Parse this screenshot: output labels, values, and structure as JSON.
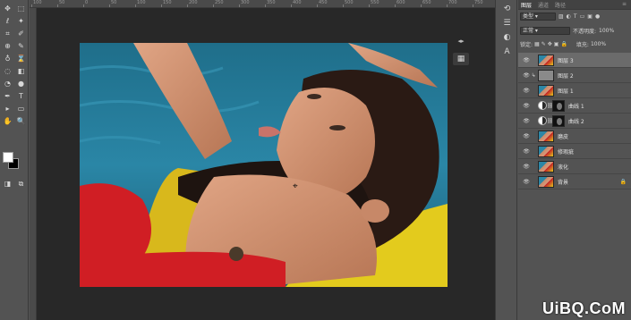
{
  "tools": {
    "rows": [
      [
        "move-icon",
        "marquee-icon"
      ],
      [
        "lasso-icon",
        "magic-wand-icon"
      ],
      [
        "crop-icon",
        "eyedropper-icon"
      ],
      [
        "healing-icon",
        "brush-icon"
      ],
      [
        "stamp-icon",
        "history-brush-icon"
      ],
      [
        "eraser-icon",
        "gradient-icon"
      ],
      [
        "blur-icon",
        "dodge-icon"
      ],
      [
        "pen-icon",
        "type-icon"
      ],
      [
        "path-select-icon",
        "shape-icon"
      ],
      [
        "hand-icon",
        "zoom-icon"
      ]
    ],
    "glyphs": [
      "✥",
      "⬚",
      "ℓ",
      "✦",
      "⌗",
      "✐",
      "⊕",
      "✎",
      "♁",
      "⌛",
      "◌",
      "◧",
      "◔",
      "●",
      "✒",
      "T",
      "▸",
      "▭",
      "✋",
      "🔍"
    ]
  },
  "ruler": {
    "labels": [
      "100",
      "50",
      "0",
      "50",
      "100",
      "150",
      "200",
      "250",
      "300",
      "350",
      "400",
      "450",
      "500",
      "550",
      "600",
      "650",
      "700",
      "750"
    ]
  },
  "panel_tabs": {
    "layers": "图层",
    "channels": "通道",
    "paths": "路径"
  },
  "filter": {
    "kind": "类型",
    "blend_mode": "正常",
    "opacity_label": "不透明度:",
    "opacity_value": "100%",
    "lock_label": "锁定:",
    "fill_label": "填充:",
    "fill_value": "100%"
  },
  "layers": [
    {
      "name": "图层 3",
      "type": "photo",
      "selected": true
    },
    {
      "name": "图层 2",
      "type": "grey",
      "clipped": true
    },
    {
      "name": "图层 1",
      "type": "photo"
    },
    {
      "name": "曲线 1",
      "type": "adjust"
    },
    {
      "name": "曲线 2",
      "type": "adjust"
    },
    {
      "name": "磨皮",
      "type": "photo"
    },
    {
      "name": "修瑕疵",
      "type": "photo"
    },
    {
      "name": "液化",
      "type": "photo"
    },
    {
      "name": "背景",
      "type": "photo",
      "locked": true
    }
  ],
  "watermark": "UiBQ.CoM",
  "colors": {
    "panel_bg": "#535353",
    "canvas_bg": "#282828",
    "selected_layer": "#6b6b6b",
    "foreground_swatch": "#ffffff",
    "background_swatch": "#000000"
  }
}
